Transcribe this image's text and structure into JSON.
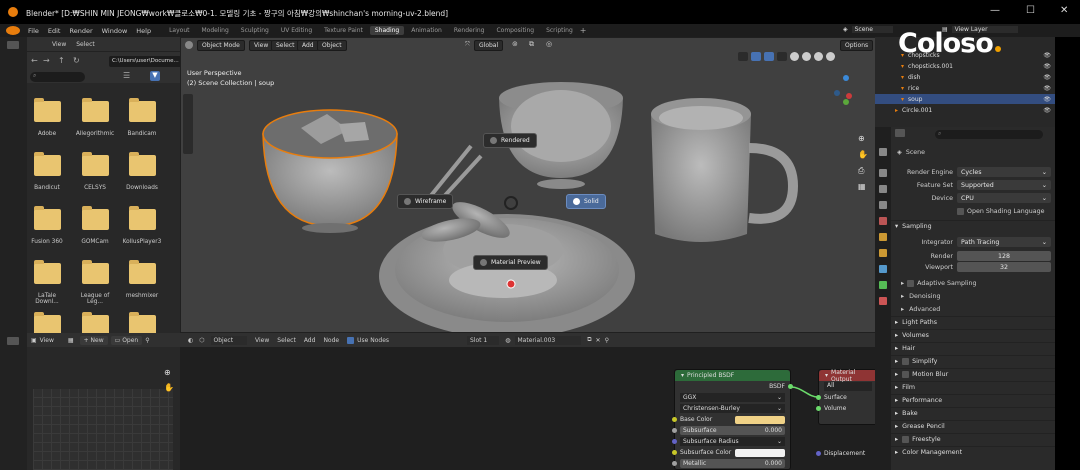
{
  "window": {
    "title": "Blender* [D:₩SHIN MIN JEONG₩work₩클로소₩0-1. 모델링 기초 - 짱구의 아침₩강의₩shinchan's morning-uv-2.blend]"
  },
  "menubar": {
    "menus": [
      "File",
      "Edit",
      "Render",
      "Window",
      "Help"
    ],
    "workspaces": [
      "Layout",
      "Modeling",
      "Sculpting",
      "UV Editing",
      "Texture Paint",
      "Shading",
      "Animation",
      "Rendering",
      "Compositing",
      "Scripting"
    ],
    "active_workspace": "Shading",
    "scene_value": "Scene",
    "view_layer_value": "View Layer"
  },
  "brand": {
    "watermark": "Coloso"
  },
  "file_browser": {
    "menus": [
      "View",
      "Select"
    ],
    "path": "C:\\Users\\user\\Docume...",
    "folders": [
      "Adobe",
      "Allegorithmic",
      "Bandicam",
      "Bandicut",
      "CELSYS",
      "Downloads",
      "Fusion 360",
      "GOMCam",
      "KollusPlayer3",
      "LaTale Downl...",
      "League of Leg...",
      "meshmixer"
    ]
  },
  "viewport": {
    "mode": "Object Mode",
    "menus": [
      "View",
      "Select",
      "Add",
      "Object"
    ],
    "transform_orientation": "Global",
    "options_label": "Options",
    "overlay_title": "User Perspective",
    "overlay_subtitle": "(2) Scene Collection | soup",
    "pie_menu": {
      "rendered": "Rendered",
      "wireframe": "Wireframe",
      "solid": "Solid",
      "material_preview": "Material Preview"
    }
  },
  "outliner": {
    "items": [
      {
        "name": "chopsticks",
        "selected": false
      },
      {
        "name": "chopsticks.001",
        "selected": false
      },
      {
        "name": "dish",
        "selected": false
      },
      {
        "name": "rice",
        "selected": false
      },
      {
        "name": "soup",
        "selected": true
      },
      {
        "name": "Circle.001",
        "selected": false
      }
    ]
  },
  "properties": {
    "context": "Scene",
    "render_engine_label": "Render Engine",
    "render_engine": "Cycles",
    "feature_set_label": "Feature Set",
    "feature_set": "Supported",
    "device_label": "Device",
    "device": "CPU",
    "open_shading_language": "Open Shading Language",
    "sampling_section": "Sampling",
    "integrator_label": "Integrator",
    "integrator": "Path Tracing",
    "render_label": "Render",
    "render_samples": "128",
    "viewport_label": "Viewport",
    "viewport_samples": "32",
    "subsections": [
      "Adaptive Sampling",
      "Denoising",
      "Advanced"
    ],
    "sections": [
      "Light Paths",
      "Volumes",
      "Hair",
      "Simplify",
      "Motion Blur",
      "Film",
      "Performance",
      "Bake",
      "Grease Pencil",
      "Freestyle",
      "Color Management"
    ]
  },
  "image_editor": {
    "view_menu": "View",
    "new_label": "New",
    "open_label": "Open"
  },
  "node_editor": {
    "type": "Object",
    "menus": [
      "View",
      "Select",
      "Add",
      "Node"
    ],
    "use_nodes": "Use Nodes",
    "slot": "Slot 1",
    "material": "Material.003",
    "principled": {
      "title": "Principled BSDF",
      "output": "BSDF",
      "distribution": "GGX",
      "subsurface_method": "Christensen-Burley",
      "base_color": "Base Color",
      "subsurface": "Subsurface",
      "subsurface_value": "0.000",
      "subsurface_radius": "Subsurface Radius",
      "subsurface_color": "Subsurface Color",
      "metallic": "Metallic",
      "metallic_value": "0.000"
    },
    "output_node": {
      "title": "Material Output",
      "target": "All",
      "surface": "Surface",
      "volume": "Volume",
      "displacement": "Displacement"
    }
  },
  "colors": {
    "accent_orange": "#e87d0d",
    "selection_blue": "#334d80",
    "shader_node_green": "#2d6b3a",
    "output_node_red": "#8f3434"
  }
}
